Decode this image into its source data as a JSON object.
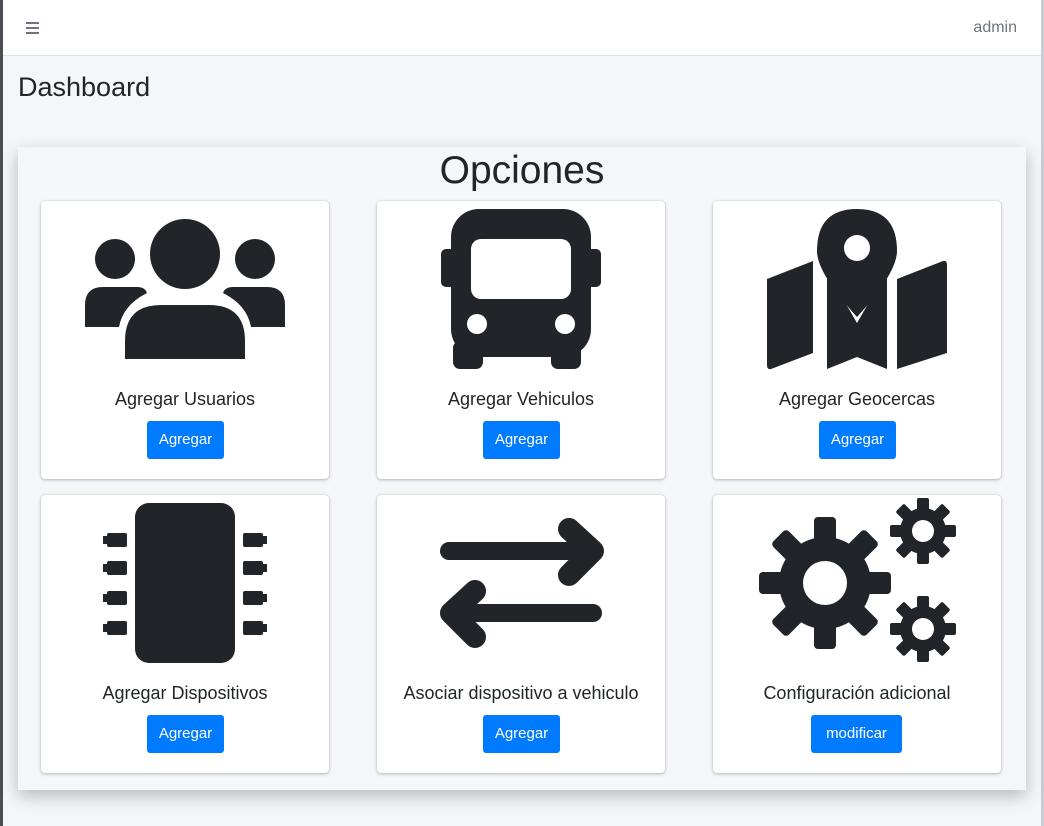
{
  "header": {
    "user": "admin",
    "menu_icon": "bars-icon"
  },
  "page": {
    "title": "Dashboard"
  },
  "panel": {
    "title": "Opciones",
    "cards": [
      {
        "label": "Agregar Usuarios",
        "button": "Agregar",
        "icon": "users-icon"
      },
      {
        "label": "Agregar Vehiculos",
        "button": "Agregar",
        "icon": "bus-icon"
      },
      {
        "label": "Agregar Geocercas",
        "button": "Agregar",
        "icon": "map-location-icon"
      },
      {
        "label": "Agregar Dispositivos",
        "button": "Agregar",
        "icon": "microchip-icon"
      },
      {
        "label": "Asociar dispositivo a vehiculo",
        "button": "Agregar",
        "icon": "exchange-arrows-icon"
      },
      {
        "label": "Configuración adicional",
        "button": "modificar",
        "icon": "cogs-icon"
      }
    ]
  },
  "colors": {
    "primary": "#007bff",
    "icon": "#212529",
    "background": "#f4f6f9"
  }
}
